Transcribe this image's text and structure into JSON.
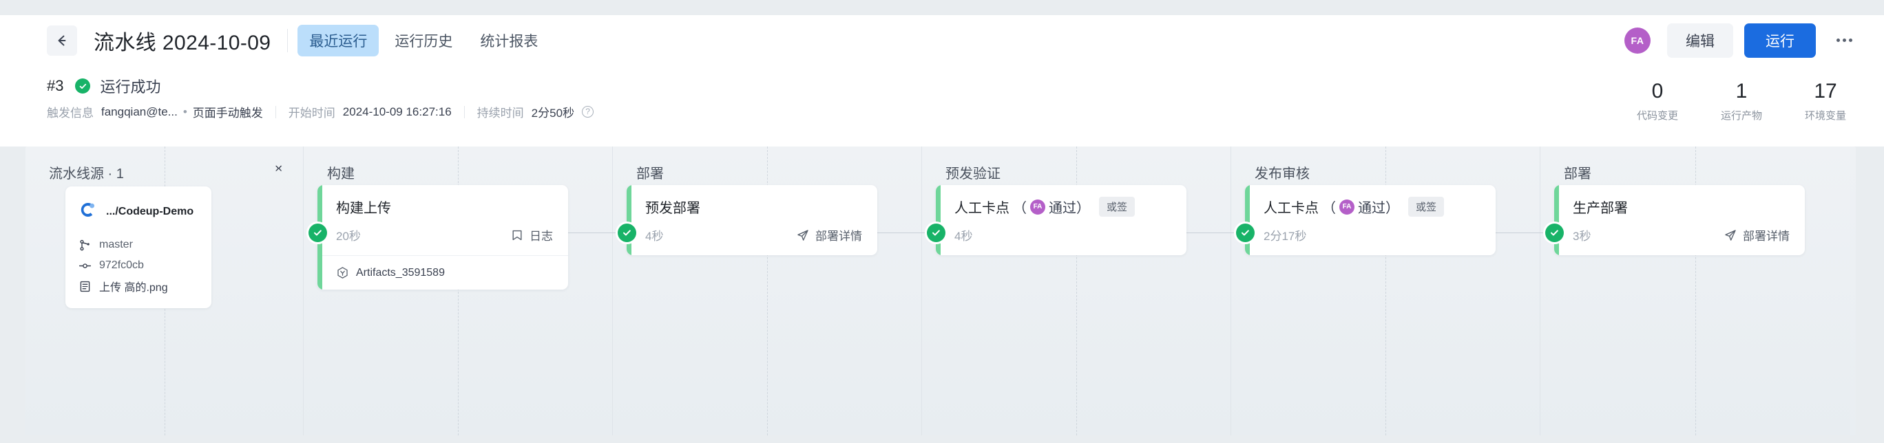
{
  "header": {
    "back_icon": "arrow-left-icon",
    "title": "流水线 2024-10-09",
    "tabs": [
      {
        "label": "最近运行",
        "active": true
      },
      {
        "label": "运行历史",
        "active": false
      },
      {
        "label": "统计报表",
        "active": false
      }
    ],
    "avatar_initials": "FA",
    "avatar_color": "#b45fc8",
    "edit_label": "编辑",
    "run_label": "运行",
    "run_button_color": "#1b6ce0",
    "more_icon": "more-horizontal-icon"
  },
  "run_info": {
    "run_number": "#3",
    "status_text": "运行成功",
    "status_color": "#18b368",
    "trigger_label": "触发信息",
    "trigger_user": "fangqian@te...",
    "trigger_sep": "•",
    "trigger_mode": "页面手动触发",
    "start_label": "开始时间",
    "start_value": "2024-10-09 16:27:16",
    "duration_label": "持续时间",
    "duration_value": "2分50秒",
    "help_icon": "question-circle-icon",
    "stats": [
      {
        "value": "0",
        "label": "代码变更"
      },
      {
        "value": "1",
        "label": "运行产物"
      },
      {
        "value": "17",
        "label": "环境变量"
      }
    ]
  },
  "source_column": {
    "heading": "流水线源 · 1",
    "collapse_icon": "collapse-icon",
    "card": {
      "repo_icon": "codeup-logo-icon",
      "repo_name": ".../Codeup-Demo",
      "rows": [
        {
          "icon": "branch-icon",
          "text": "master"
        },
        {
          "icon": "commit-icon",
          "text": "972fc0cb"
        },
        {
          "icon": "message-icon",
          "text": "上传 高的.png"
        }
      ]
    }
  },
  "stages": [
    {
      "heading": "构建",
      "job": {
        "title": "构建上传",
        "duration": "20秒",
        "link_label": "日志",
        "link_icon": "log-icon",
        "status_icon": "check-circle-icon",
        "artifact": {
          "icon": "artifact-icon",
          "name": "Artifacts_3591589"
        }
      }
    },
    {
      "heading": "部署",
      "job": {
        "title": "预发部署",
        "duration": "4秒",
        "link_label": "部署详情",
        "link_icon": "deploy-icon",
        "status_icon": "check-circle-icon"
      }
    },
    {
      "heading": "预发验证",
      "job": {
        "title": "人工卡点",
        "paren_open": "（",
        "approver_initials": "FA",
        "approve_text": "通过",
        "paren_close": "）",
        "tag": "或签",
        "duration": "4秒",
        "status_icon": "check-circle-icon"
      }
    },
    {
      "heading": "发布审核",
      "job": {
        "title": "人工卡点",
        "paren_open": "（",
        "approver_initials": "FA",
        "approve_text": "通过",
        "paren_close": "）",
        "tag": "或签",
        "duration": "2分17秒",
        "status_icon": "check-circle-icon"
      }
    },
    {
      "heading": "部署",
      "job": {
        "title": "生产部署",
        "duration": "3秒",
        "link_label": "部署详情",
        "link_icon": "deploy-icon",
        "status_icon": "check-circle-icon"
      }
    }
  ]
}
